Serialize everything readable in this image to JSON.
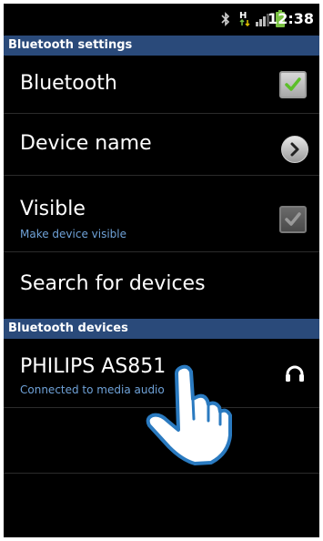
{
  "status_bar": {
    "time": "12:38",
    "icons": [
      "bluetooth-icon",
      "data-transfer-icon",
      "signal-icon",
      "battery-icon"
    ],
    "battery_color": "#7ac142"
  },
  "sections": {
    "settings_header": "Bluetooth settings",
    "devices_header": "Bluetooth devices"
  },
  "settings": {
    "bluetooth": {
      "label": "Bluetooth",
      "checked": true
    },
    "device_name": {
      "label": "Device name"
    },
    "visible": {
      "label": "Visible",
      "sublabel": "Make device visible",
      "checked": true,
      "enabled": false
    },
    "search": {
      "label": "Search for devices"
    }
  },
  "devices": [
    {
      "name": "PHILIPS AS851",
      "status": "Connected to media audio",
      "icon": "headset-icon"
    }
  ],
  "colors": {
    "header_bg": "#2a4a7a",
    "accent_text": "#6fa2d8",
    "check_green": "#5cbf2a"
  }
}
